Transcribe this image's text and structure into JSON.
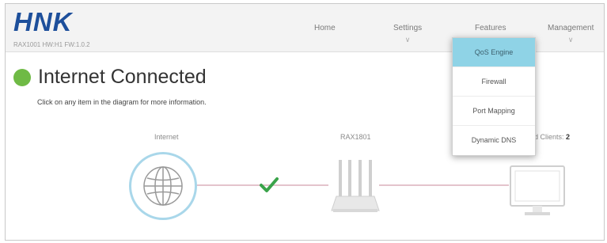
{
  "brand": {
    "logo_text": "HNK",
    "model_info": "RAX1001 HW:H1 FW:1.0.2",
    "logo_color": "#1d4f9b"
  },
  "nav": {
    "home": "Home",
    "settings": "Settings",
    "features": "Features",
    "management": "Management",
    "chevron": "∨"
  },
  "features_menu": {
    "items": [
      "QoS Engine",
      "Firewall",
      "Port Mapping",
      "Dynamic DNS"
    ],
    "active_index": 0,
    "active_color": "#8fd3e6"
  },
  "status": {
    "title": "Internet Connected",
    "color": "#6fba45",
    "hint": "Click on any item in the diagram for more information."
  },
  "diagram": {
    "internet_label": "Internet",
    "router_label": "RAX1801",
    "clients_label": "d Clients:",
    "clients_count": "2",
    "link_ok_icon": "checkmark-icon"
  }
}
